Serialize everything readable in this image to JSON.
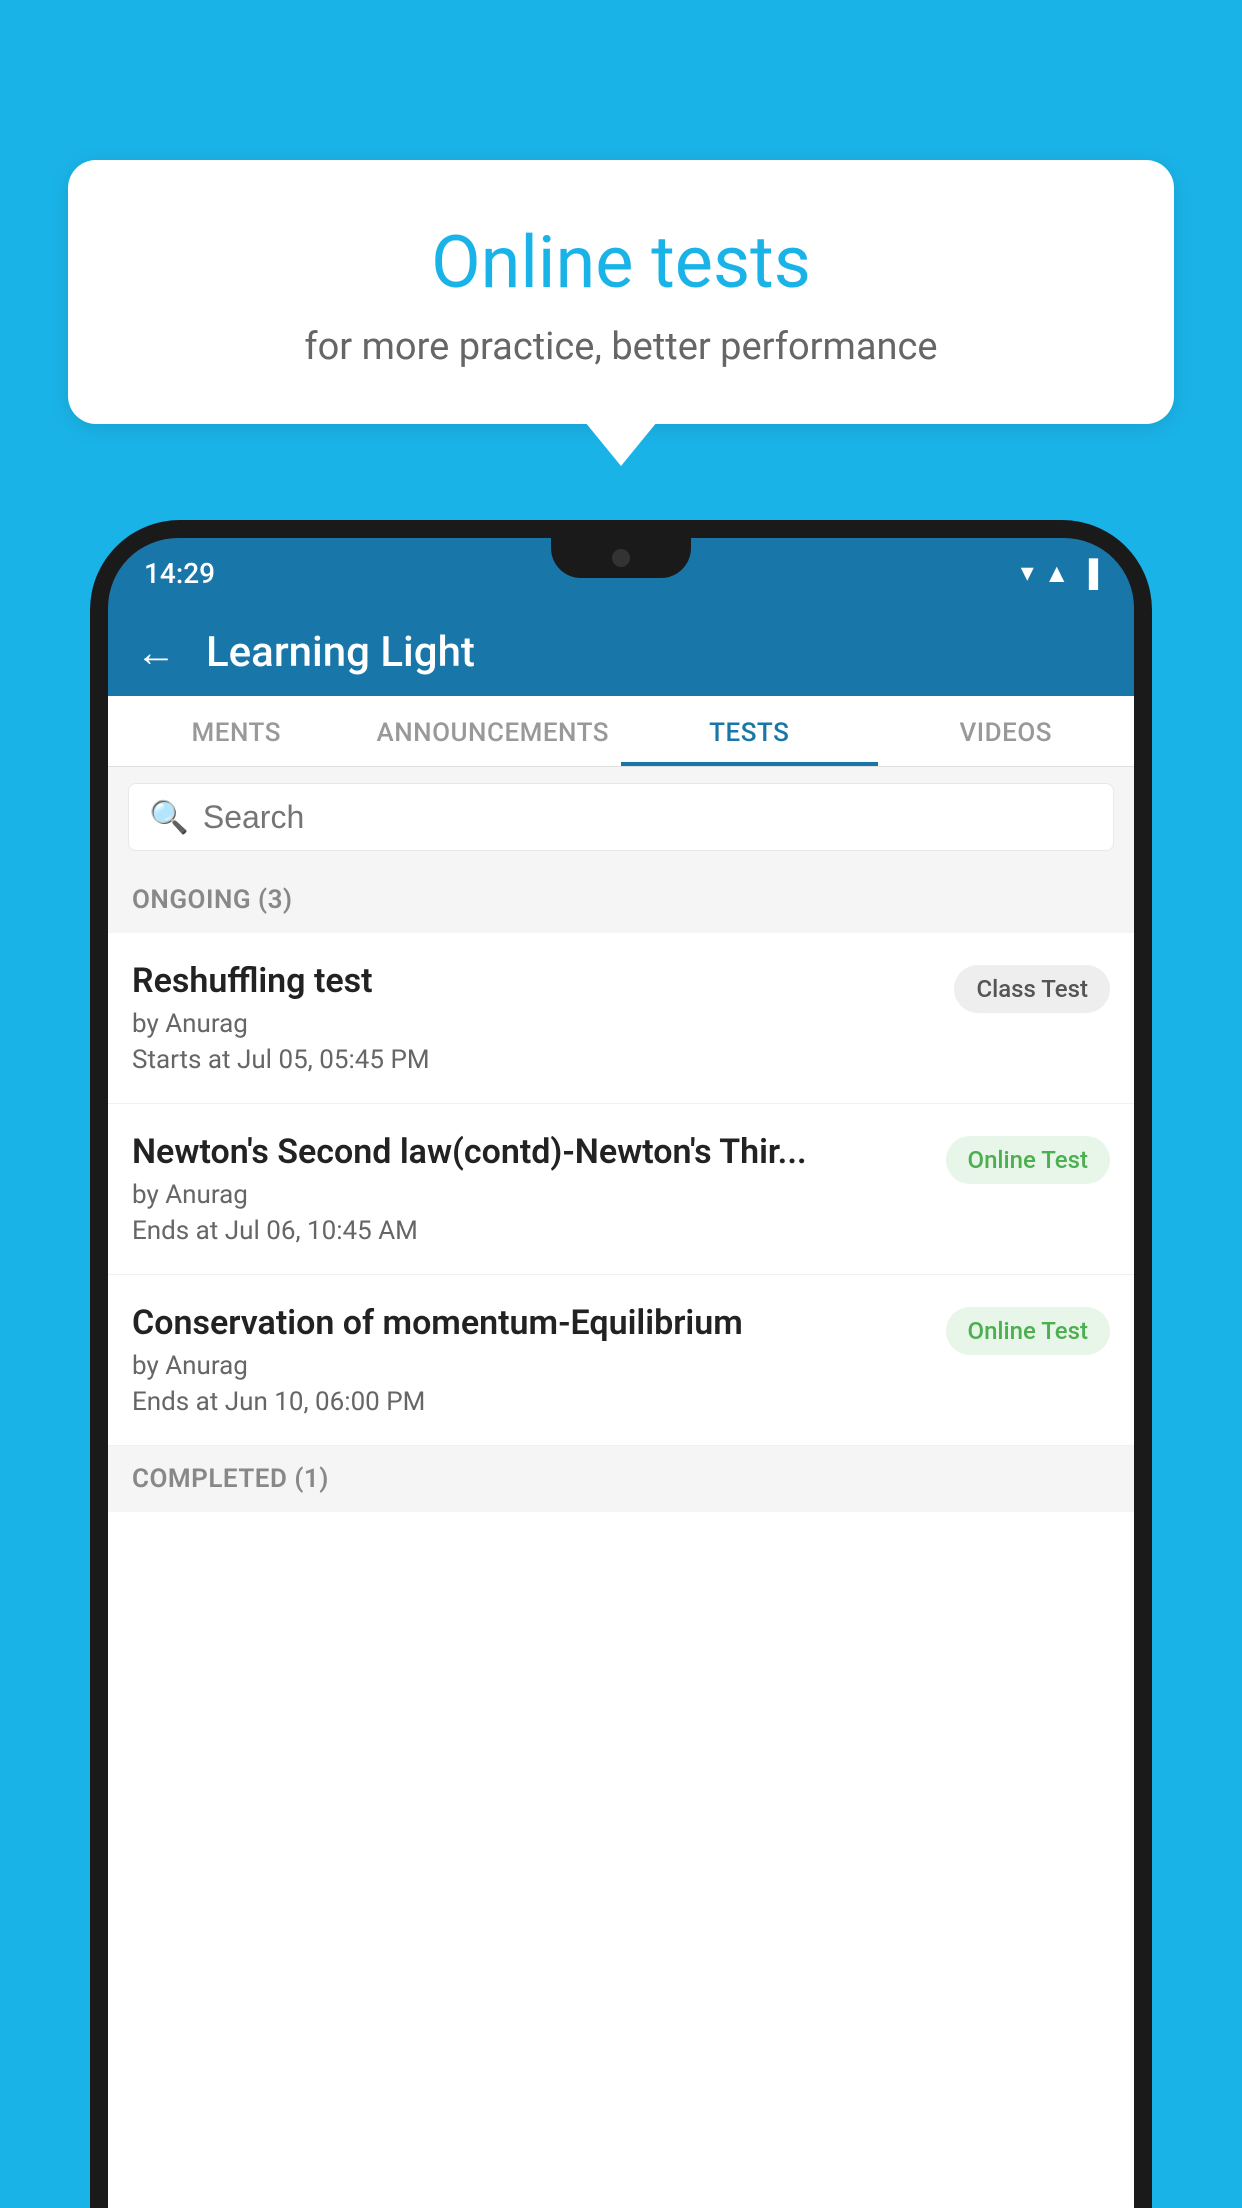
{
  "background": {
    "color": "#1ab3e8"
  },
  "speech_bubble": {
    "title": "Online tests",
    "subtitle": "for more practice, better performance"
  },
  "phone": {
    "status_bar": {
      "time": "14:29",
      "icons": [
        "wifi",
        "signal",
        "battery"
      ]
    },
    "app_bar": {
      "back_label": "←",
      "title": "Learning Light"
    },
    "tabs": [
      {
        "label": "MENTS",
        "active": false
      },
      {
        "label": "ANNOUNCEMENTS",
        "active": false
      },
      {
        "label": "TESTS",
        "active": true
      },
      {
        "label": "VIDEOS",
        "active": false
      }
    ],
    "search": {
      "placeholder": "Search"
    },
    "ongoing_section": {
      "header": "ONGOING (3)",
      "items": [
        {
          "title": "Reshuffling test",
          "author": "by Anurag",
          "date": "Starts at  Jul 05, 05:45 PM",
          "badge": "Class Test",
          "badge_type": "class"
        },
        {
          "title": "Newton's Second law(contd)-Newton's Thir...",
          "author": "by Anurag",
          "date": "Ends at  Jul 06, 10:45 AM",
          "badge": "Online Test",
          "badge_type": "online"
        },
        {
          "title": "Conservation of momentum-Equilibrium",
          "author": "by Anurag",
          "date": "Ends at  Jun 10, 06:00 PM",
          "badge": "Online Test",
          "badge_type": "online"
        }
      ]
    },
    "completed_section": {
      "header": "COMPLETED (1)"
    }
  }
}
